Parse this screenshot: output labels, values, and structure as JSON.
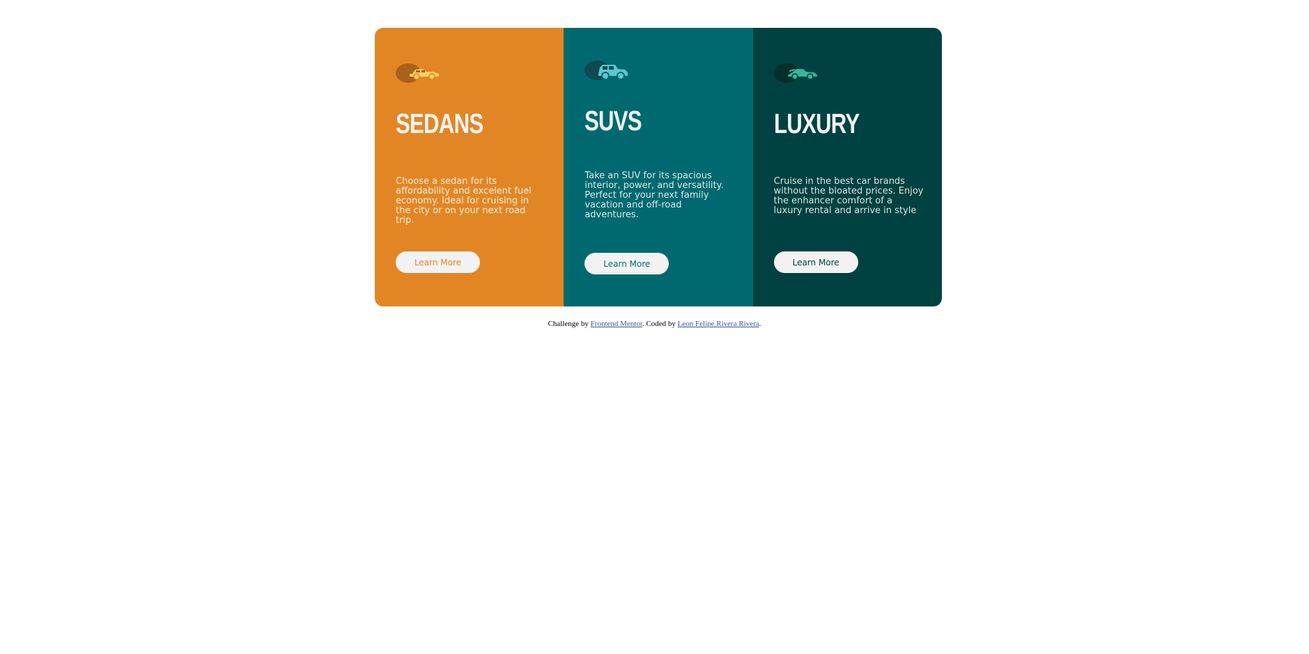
{
  "colors": {
    "sedans_bg": "#e28625",
    "suvs_bg": "#006970",
    "luxury_bg": "#004241",
    "button_bg": "#f2f2f2",
    "link": "#3e52a3"
  },
  "cards": [
    {
      "icon": "sedan-car-icon",
      "title": "SEDANS",
      "description": "Choose a sedan for its affordability and excelent fuel economy. Ideal for cruising in the city or on your next road trip.",
      "button_label": "Learn More"
    },
    {
      "icon": "suv-car-icon",
      "title": "SUVS",
      "description": "Take an SUV for its spacious interior, power, and versatility. Perfect for your next family vacation and off-road adventures.",
      "button_label": "Learn More"
    },
    {
      "icon": "luxury-car-icon",
      "title": "LUXURY",
      "description": "Cruise in the best car brands without the bloated prices. Enjoy the enhancer comfort of a luxury rental and arrive in style",
      "button_label": "Learn More"
    }
  ],
  "attribution": {
    "prefix": "Challenge by ",
    "challenge_link": "Frontend Mentor",
    "middle": ". Coded by ",
    "author_link": "Leon Felipe Rivera Rivera",
    "suffix": "."
  }
}
